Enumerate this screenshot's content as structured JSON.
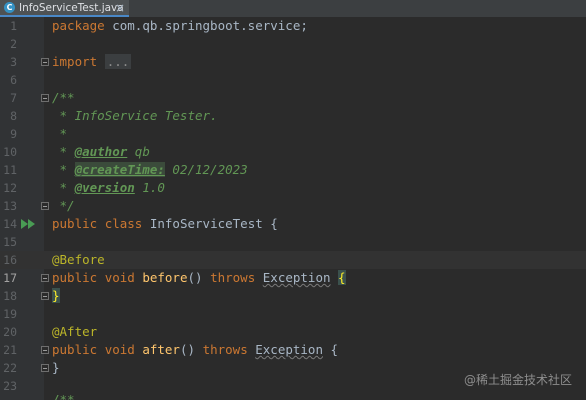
{
  "tab": {
    "icon_letter": "C",
    "filename": "InfoServiceTest.java",
    "close": "×"
  },
  "gutter": {
    "lines": [
      "1",
      "2",
      "3",
      "6",
      "7",
      "8",
      "9",
      "10",
      "11",
      "12",
      "13",
      "14",
      "15",
      "16",
      "17",
      "18",
      "19",
      "20",
      "21",
      "22",
      "23"
    ],
    "current_line": "17"
  },
  "code": {
    "l1": {
      "kw": "package",
      "rest": " com.qb.springboot.service;"
    },
    "l3": {
      "kw": "import",
      "folded": "..."
    },
    "l7": "/**",
    "l8": " * InfoService Tester.",
    "l9": " *",
    "l10": {
      "prefix": " * ",
      "tag": "@author",
      "val": " qb"
    },
    "l11": {
      "prefix": " * ",
      "tag": "@createTime:",
      "val": " 02/12/2023"
    },
    "l12": {
      "prefix": " * ",
      "tag": "@version",
      "val": " 1.0"
    },
    "l13": " */",
    "l14": {
      "kw1": "public",
      "kw2": "class",
      "name": "InfoServiceTest",
      "brace": "{"
    },
    "l16": "@Before",
    "l17": {
      "kw1": "public",
      "kw2": "void",
      "fn": "before",
      "parens": "()",
      "kw3": "throws",
      "ex": "Exception",
      "brace": "{"
    },
    "l18": "}",
    "l20": "@After",
    "l21": {
      "kw1": "public",
      "kw2": "void",
      "fn": "after",
      "parens": "()",
      "kw3": "throws",
      "ex": "Exception",
      "brace": "{"
    },
    "l22": "}",
    "l23": "/**"
  },
  "watermark": "@稀土掘金技术社区",
  "colors": {
    "background": "#2b2b2b",
    "keyword": "#cc7832",
    "comment": "#629755",
    "annotation": "#bbb529",
    "function": "#ffc66d",
    "text": "#a9b7c6"
  }
}
